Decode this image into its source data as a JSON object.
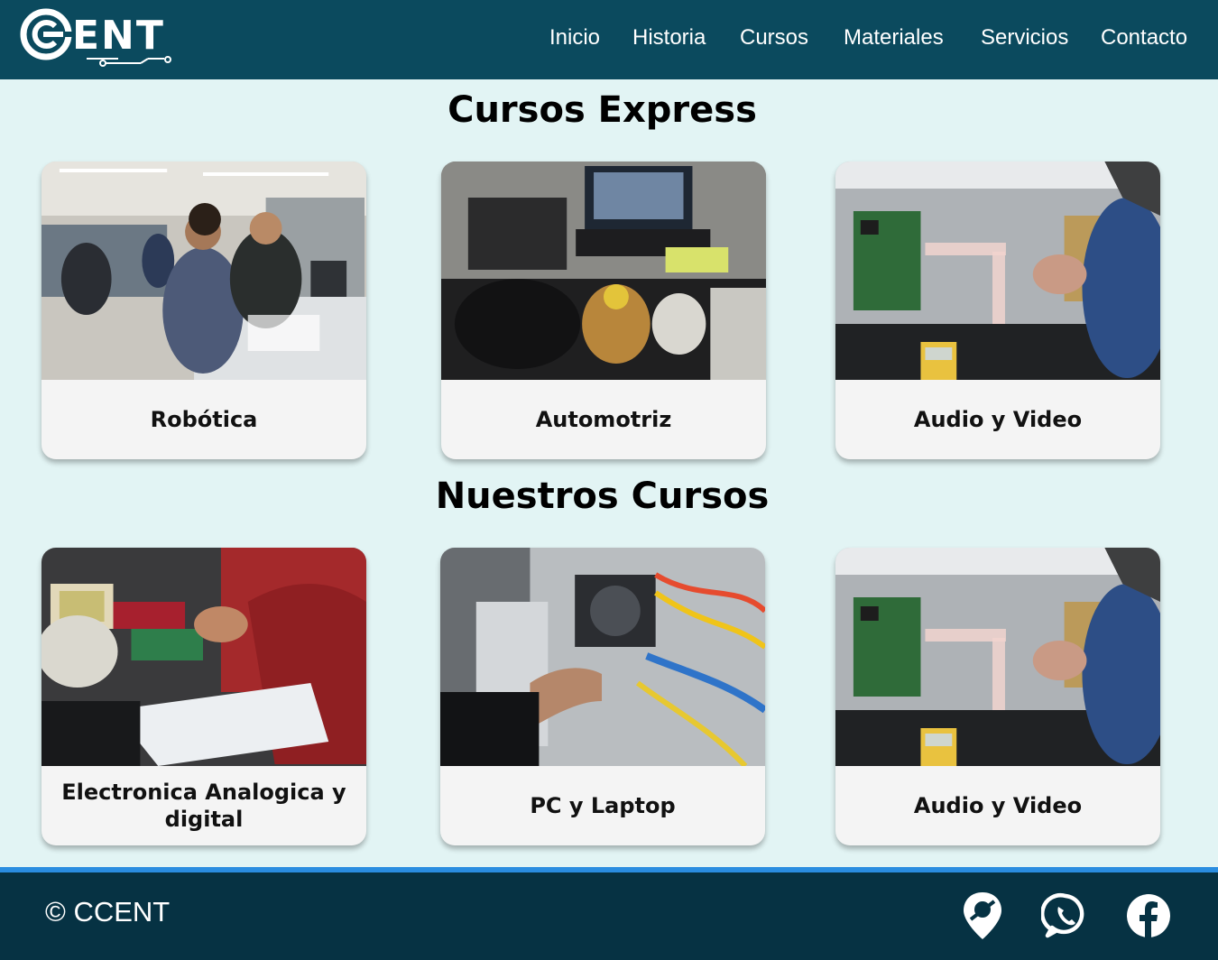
{
  "brand": {
    "logo_text": "ENT",
    "name": "CCENT"
  },
  "nav": {
    "items": [
      {
        "label": "Inicio"
      },
      {
        "label": "Historia"
      },
      {
        "label": "Cursos"
      },
      {
        "label": "Materiales"
      },
      {
        "label": "Servicios"
      },
      {
        "label": "Contacto"
      }
    ]
  },
  "sections": [
    {
      "title": "Cursos Express",
      "cards": [
        {
          "label": "Robótica",
          "image": "robotics-lab-photo"
        },
        {
          "label": "Automotriz",
          "image": "car-engine-photo"
        },
        {
          "label": "Audio y Video",
          "image": "tv-board-repair-photo"
        }
      ]
    },
    {
      "title": "Nuestros Cursos",
      "cards": [
        {
          "label": "Electronica Analogica y digital",
          "image": "circuit-soldering-photo"
        },
        {
          "label": "PC y Laptop",
          "image": "pc-wiring-photo"
        },
        {
          "label": "Audio y Video",
          "image": "tv-board-repair-photo"
        }
      ]
    }
  ],
  "footer": {
    "copyright": "© CCENT",
    "social": [
      {
        "icon": "map-pin-icon"
      },
      {
        "icon": "whatsapp-icon"
      },
      {
        "icon": "facebook-icon"
      }
    ]
  },
  "colors": {
    "header_bg": "#0b4a5e",
    "page_bg": "#e2f4f4",
    "footer_bg": "#063243",
    "footer_accent": "#2a8de0",
    "card_bg": "#f4f4f4"
  }
}
